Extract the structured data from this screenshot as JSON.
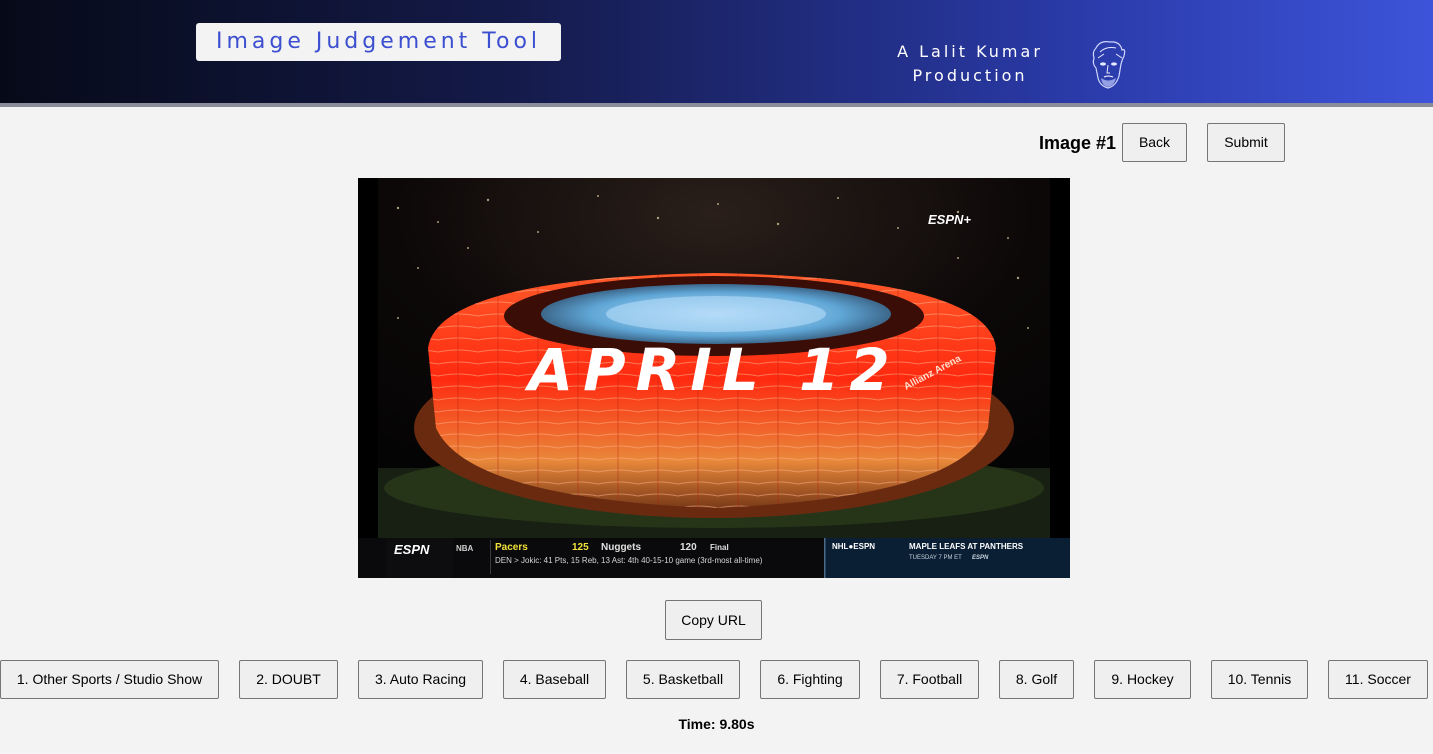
{
  "header": {
    "app_title": "Image Judgement Tool",
    "credit_line1": "A Lalit Kumar",
    "credit_line2": "Production",
    "avatar_icon": "portrait-sketch-icon"
  },
  "toolbar": {
    "image_label": "Image #1",
    "back_label": "Back",
    "submit_label": "Submit"
  },
  "frame": {
    "network_logo": "ESPN+",
    "headline": "APRIL 12",
    "venue_sign": "Allianz Arena",
    "ticker": {
      "brand": "ESPN",
      "league": "NBA",
      "team1": "Pacers",
      "score1": "125",
      "team2": "Nuggets",
      "score2": "120",
      "status": "Final",
      "line2": "DEN  >  Jokic: 41 Pts, 15 Reb, 13 Ast: 4th 40-15-10 game (3rd-most all-time)",
      "promo_brand": "NHL●ESPN",
      "promo_title": "MAPLE LEAFS AT PANTHERS",
      "promo_time": "TUESDAY 7 PM ET",
      "promo_net": "ESPN"
    }
  },
  "copy_url_label": "Copy URL",
  "categories": [
    "1. Other Sports / Studio Show",
    "2. DOUBT",
    "3. Auto Racing",
    "4. Baseball",
    "5. Basketball",
    "6. Fighting",
    "7. Football",
    "8. Golf",
    "9. Hockey",
    "10. Tennis",
    "11. Soccer"
  ],
  "timer_text": "Time: 9.80s"
}
